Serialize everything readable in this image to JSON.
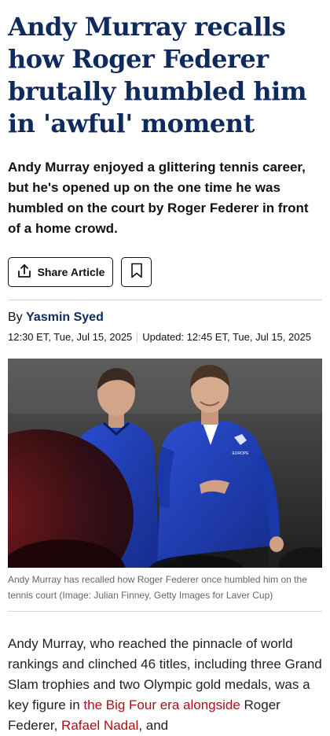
{
  "article": {
    "headline": "Andy Murray recalls how Roger Federer brutally humbled him in 'awful' moment",
    "standfirst": "Andy Murray enjoyed a glittering tennis career, but he's opened up on the one time he was humbled on the court by Roger Federer in front of a home crowd.",
    "share_label": "Share Article",
    "byline_prefix": "By",
    "author": "Yasmin Syed",
    "published": "12:30 ET, Tue, Jul 15, 2025",
    "updated": "Updated: 12:45 ET, Tue, Jul 15, 2025",
    "image_caption": "Andy Murray has recalled how Roger Federer once humbled him on the tennis court (Image: Julian Finney, Getty Images for Laver Cup)",
    "jacket_badge_text": "EUROPE",
    "body": {
      "text_1": "Andy Murray, who reached the pinnacle of world rankings and clinched 46 titles, including three Grand Slam trophies and two Olympic gold medals, was a key figure in ",
      "link_1": "the Big Four era alongside",
      "text_2": " Roger Federer, ",
      "link_2": "Rafael Nadal",
      "text_3": ", and"
    }
  },
  "colors": {
    "headline": "#0f2a5c",
    "link": "#b00d18",
    "jacket": "#1f3fb8"
  },
  "icons": {
    "share": "share-icon",
    "bookmark": "bookmark-icon"
  }
}
